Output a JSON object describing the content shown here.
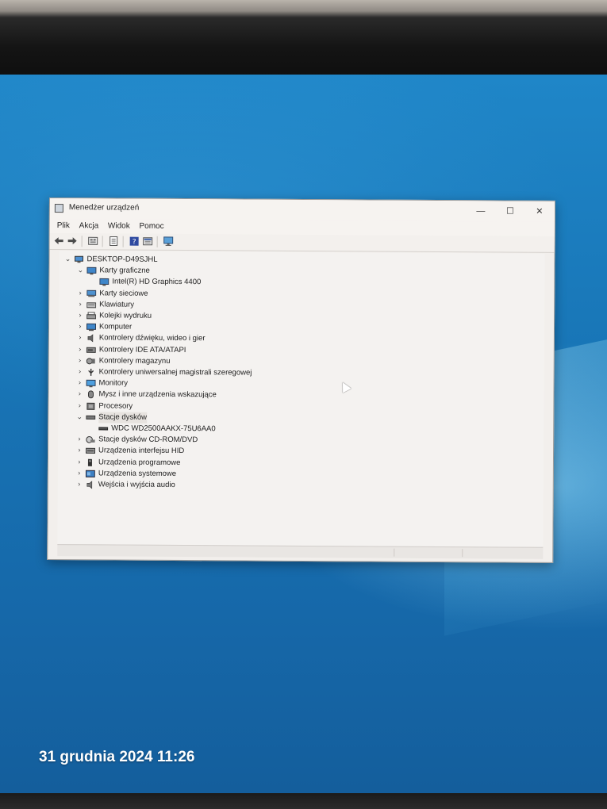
{
  "window": {
    "title": "Menedżer urządzeń",
    "controls": {
      "minimize": "—",
      "maximize": "☐",
      "close": "✕"
    }
  },
  "menu": [
    "Plik",
    "Akcja",
    "Widok",
    "Pomoc"
  ],
  "toolbar_icons": [
    "back-arrow-icon",
    "forward-arrow-icon",
    "device-list-icon",
    "properties-icon",
    "help-icon",
    "view-icon",
    "monitor-icon"
  ],
  "tree": {
    "root": "DESKTOP-D49SJHL",
    "nodes": [
      {
        "label": "Karty graficzne",
        "expanded": true,
        "icon": "display-adapter-icon",
        "children": [
          "Intel(R) HD Graphics 4400"
        ]
      },
      {
        "label": "Karty sieciowe",
        "expanded": false,
        "icon": "network-adapter-icon"
      },
      {
        "label": "Klawiatury",
        "expanded": false,
        "icon": "keyboard-icon"
      },
      {
        "label": "Kolejki wydruku",
        "expanded": false,
        "icon": "printer-icon"
      },
      {
        "label": "Komputer",
        "expanded": false,
        "icon": "computer-icon"
      },
      {
        "label": "Kontrolery dźwięku, wideo i gier",
        "expanded": false,
        "icon": "speaker-icon"
      },
      {
        "label": "Kontrolery IDE ATA/ATAPI",
        "expanded": false,
        "icon": "ide-controller-icon"
      },
      {
        "label": "Kontrolery magazynu",
        "expanded": false,
        "icon": "storage-controller-icon"
      },
      {
        "label": "Kontrolery uniwersalnej magistrali szeregowej",
        "expanded": false,
        "icon": "usb-icon"
      },
      {
        "label": "Monitory",
        "expanded": false,
        "icon": "monitor-icon"
      },
      {
        "label": "Mysz i inne urządzenia wskazujące",
        "expanded": false,
        "icon": "mouse-icon"
      },
      {
        "label": "Procesory",
        "expanded": false,
        "icon": "processor-icon"
      },
      {
        "label": "Stacje dysków",
        "expanded": true,
        "icon": "disk-drive-icon",
        "children": [
          "WDC WD2500AAKX-75U6AA0"
        ]
      },
      {
        "label": "Stacje dysków CD-ROM/DVD",
        "expanded": false,
        "icon": "cdrom-icon"
      },
      {
        "label": "Urządzenia interfejsu HID",
        "expanded": false,
        "icon": "hid-icon"
      },
      {
        "label": "Urządzenia programowe",
        "expanded": false,
        "icon": "software-device-icon"
      },
      {
        "label": "Urządzenia systemowe",
        "expanded": false,
        "icon": "system-device-icon"
      },
      {
        "label": "Wejścia i wyjścia audio",
        "expanded": false,
        "icon": "audio-io-icon"
      }
    ]
  },
  "photo_timestamp": "31 grudnia 2024 11:26"
}
